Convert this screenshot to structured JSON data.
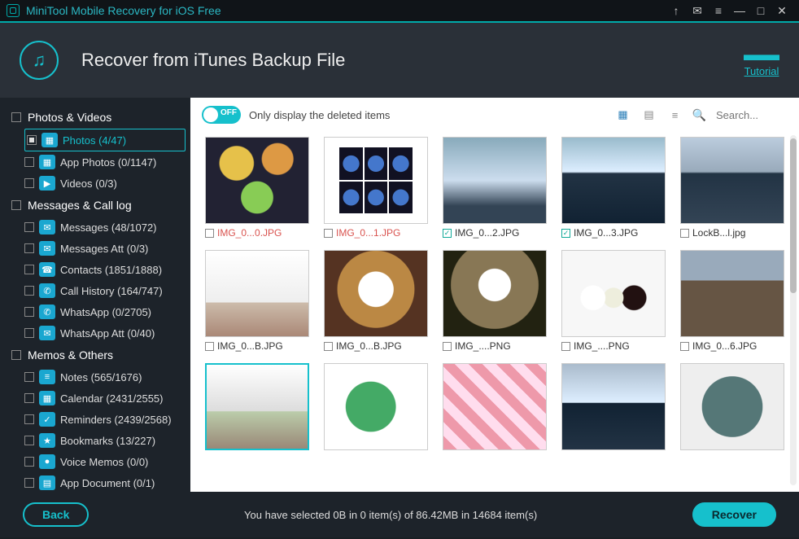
{
  "app_title": "MiniTool Mobile Recovery for iOS Free",
  "header": {
    "title": "Recover from iTunes Backup File",
    "tutorial": "Tutorial"
  },
  "toolbar": {
    "toggle_state": "OFF",
    "toggle_label": "Only display the deleted items",
    "search_placeholder": "Search..."
  },
  "sidebar": {
    "groups": [
      {
        "name": "Photos & Videos",
        "items": [
          {
            "label": "Photos (4/47)",
            "active": true,
            "partial": true,
            "glyph": "▦"
          },
          {
            "label": "App Photos (0/1147)",
            "glyph": "▦"
          },
          {
            "label": "Videos (0/3)",
            "glyph": "▶"
          }
        ]
      },
      {
        "name": "Messages & Call log",
        "items": [
          {
            "label": "Messages (48/1072)",
            "glyph": "✉"
          },
          {
            "label": "Messages Att (0/3)",
            "glyph": "✉"
          },
          {
            "label": "Contacts (1851/1888)",
            "glyph": "☎"
          },
          {
            "label": "Call History (164/747)",
            "glyph": "✆"
          },
          {
            "label": "WhatsApp (0/2705)",
            "glyph": "✆"
          },
          {
            "label": "WhatsApp Att (0/40)",
            "glyph": "✉"
          }
        ]
      },
      {
        "name": "Memos & Others",
        "items": [
          {
            "label": "Notes (565/1676)",
            "glyph": "≡"
          },
          {
            "label": "Calendar (2431/2555)",
            "glyph": "▦"
          },
          {
            "label": "Reminders (2439/2568)",
            "glyph": "✓"
          },
          {
            "label": "Bookmarks (13/227)",
            "glyph": "★"
          },
          {
            "label": "Voice Memos (0/0)",
            "glyph": "●"
          },
          {
            "label": "App Document (0/1)",
            "glyph": "▤"
          }
        ]
      }
    ]
  },
  "files": [
    {
      "name": "IMG_0...0.JPG",
      "status": "deleted",
      "thumb": "t-food"
    },
    {
      "name": "IMG_0...1.JPG",
      "status": "deleted",
      "thumb": "t-grid6"
    },
    {
      "name": "IMG_0...2.JPG",
      "status": "recov",
      "thumb": "t-sky"
    },
    {
      "name": "IMG_0...3.JPG",
      "status": "recov",
      "thumb": "t-sea"
    },
    {
      "name": "LockB...l.jpg",
      "status": "",
      "thumb": "t-wave"
    },
    {
      "name": "IMG_0...B.JPG",
      "status": "",
      "thumb": "t-room"
    },
    {
      "name": "IMG_0...B.JPG",
      "status": "",
      "thumb": "t-dog1"
    },
    {
      "name": "IMG_....PNG",
      "status": "",
      "thumb": "t-dog2"
    },
    {
      "name": "IMG_....PNG",
      "status": "",
      "thumb": "t-eggs"
    },
    {
      "name": "IMG_0...6.JPG",
      "status": "",
      "thumb": "t-husky"
    },
    {
      "name": "",
      "status": "",
      "thumb": "t-room2",
      "sel": true
    },
    {
      "name": "",
      "status": "",
      "thumb": "t-plant"
    },
    {
      "name": "",
      "status": "",
      "thumb": "t-pops"
    },
    {
      "name": "",
      "status": "",
      "thumb": "t-ocean"
    },
    {
      "name": "",
      "status": "",
      "thumb": "t-bush"
    }
  ],
  "footer": {
    "status": "You have selected 0B in 0 item(s) of 86.42MB in 14684 item(s)",
    "back": "Back",
    "recover": "Recover"
  }
}
